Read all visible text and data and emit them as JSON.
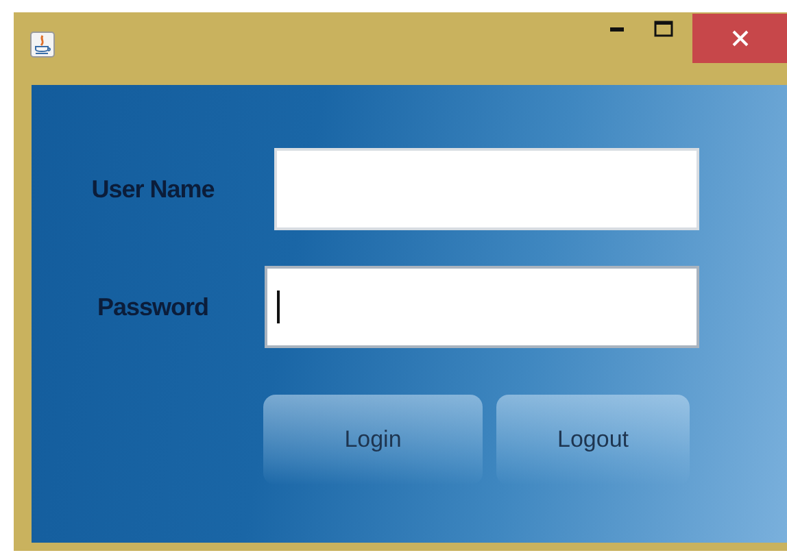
{
  "fields": [
    {
      "label": "User Name",
      "focused": false
    },
    {
      "label": "Password",
      "focused": true
    }
  ],
  "buttons": [
    "Login",
    "Logout"
  ]
}
